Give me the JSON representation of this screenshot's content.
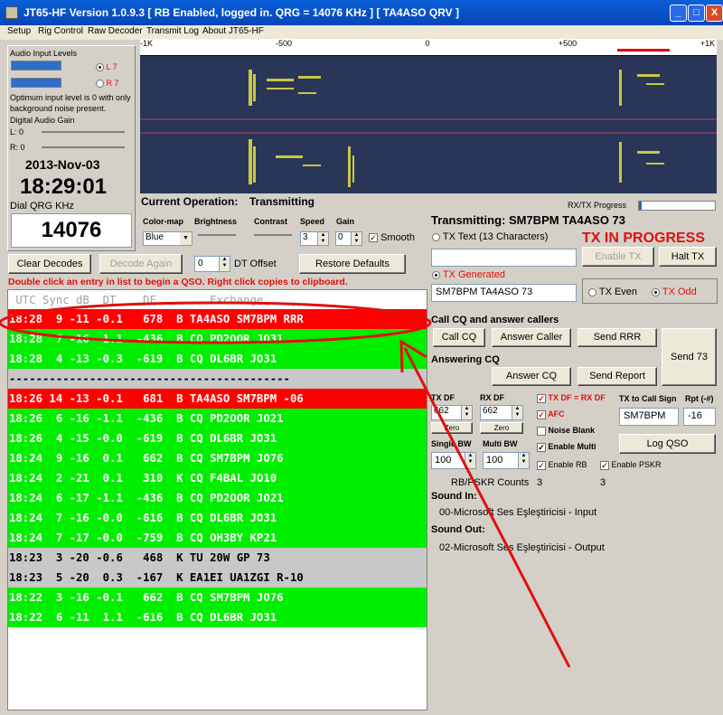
{
  "window": {
    "title": "JT65-HF Version 1.0.9.3  [ RB Enabled, logged in.  QRG = 14076 KHz ] [ TA4ASO QRV ]",
    "min": "_",
    "max": "□",
    "close": "X"
  },
  "menu": [
    "Setup",
    "Rig Control",
    "Raw Decoder",
    "Transmit Log",
    "About JT65-HF"
  ],
  "audio": {
    "title": "Audio Input Levels",
    "left": "L 7",
    "right": "R 7",
    "note": "Optimum input level is 0 with only background noise present.",
    "gain_title": "Digital Audio Gain",
    "gain_l": "L: 0",
    "gain_r": "R: 0"
  },
  "clock": {
    "date": "2013-Nov-03",
    "time": "18:29:01",
    "qrg_label": "Dial QRG KHz",
    "qrg": "14076"
  },
  "scale": {
    "labels": [
      "-1K",
      "-500",
      "0",
      "+500",
      "+1K"
    ]
  },
  "operation": {
    "label": "Current Operation:",
    "value": "Transmitting",
    "progress_label": "RX/TX Progress"
  },
  "waterfall_controls": {
    "colormap_label": "Color-map",
    "colormap": "Blue",
    "brightness": "Brightness",
    "contrast": "Contrast",
    "speed": "Speed",
    "speed_val": "3",
    "gain": "Gain",
    "gain_val": "0",
    "smooth": "Smooth"
  },
  "decode_buttons": {
    "clear": "Clear Decodes",
    "again": "Decode Again",
    "dt_val": "0",
    "dt": "DT Offset",
    "restore": "Restore Defaults"
  },
  "hint": "Double click an entry in list to begin a QSO.  Right click copies to clipboard.",
  "decode_header": " UTC Sync dB  DT    DF        Exchange",
  "decodes": [
    {
      "text": "18:28  9 -11 -0.1   678  B TA4ASO SM7BPM RRR",
      "c": "red"
    },
    {
      "text": "18:28  7 -16 -1.1  -436  B CQ PD2OOR JO31",
      "c": "green"
    },
    {
      "text": "18:28  4 -13 -0.3  -619  B CQ DL6BR JO31",
      "c": "green"
    },
    {
      "text": "------------------------------------------",
      "c": "sep"
    },
    {
      "text": "18:26 14 -13 -0.1   681  B TA4ASO SM7BPM -06",
      "c": "red"
    },
    {
      "text": "18:26  6 -16 -1.1  -436  B CQ PD2OOR JO21",
      "c": "green"
    },
    {
      "text": "18:26  4 -15 -0.0  -619  B CQ DL6BR JO31",
      "c": "green"
    },
    {
      "text": "18:24  9 -16  0.1   662  B CQ SM7BPM JO76",
      "c": "green"
    },
    {
      "text": "18:24  2 -21  0.1   310  K CQ F4BAL JO10",
      "c": "green"
    },
    {
      "text": "18:24  6 -17 -1.1  -436  B CQ PD2OOR JO21",
      "c": "green"
    },
    {
      "text": "18:24  7 -16 -0.0  -616  B CQ DL6BR JO31",
      "c": "green"
    },
    {
      "text": "18:24  7 -17 -0.0  -759  B CQ OH3BY KP21",
      "c": "green"
    },
    {
      "text": "18:23  3 -20 -0.6   468  K TU 20W GP 73",
      "c": "gray"
    },
    {
      "text": "18:23  5 -20  0.3  -167  K EA1EI UA1ZGI R-10",
      "c": "gray"
    },
    {
      "text": "18:22  3 -16 -0.1   662  B CQ SM7BPM JO76",
      "c": "green"
    },
    {
      "text": "18:22  6 -11  1.1  -616  B CQ DL6BR JO31",
      "c": "green"
    }
  ],
  "tx": {
    "status": "Transmitting: SM7BPM TA4ASO 73",
    "in_progress": "TX IN PROGRESS",
    "tx_text_label": "TX Text (13 Characters)",
    "enable_tx": "Enable TX",
    "halt_tx": "Halt TX",
    "tx_generated": "TX Generated",
    "message": "SM7BPM TA4ASO 73",
    "tx_even": "TX Even",
    "tx_odd": "TX Odd"
  },
  "cq": {
    "title": "Call CQ and answer callers",
    "call_cq": "Call CQ",
    "answer_caller": "Answer Caller",
    "send_rrr": "Send RRR",
    "send73": "Send 73",
    "answering": "Answering CQ",
    "answer_cq": "Answer CQ",
    "send_report": "Send Report"
  },
  "df": {
    "tx_df": "TX DF",
    "tx_val": "662",
    "rx_df": "RX DF",
    "rx_val": "662",
    "zero": "Zero",
    "txeqrx": "TX DF = RX DF",
    "afc": "AFC",
    "noise": "Noise Blank",
    "enable_multi": "Enable Multi",
    "enable_rb": "Enable RB",
    "enable_pskr": "Enable PSKR",
    "single_bw": "Single BW",
    "single_val": "100",
    "multi_bw": "Multi BW",
    "multi_val": "100",
    "tx_to": "TX to Call Sign",
    "rpt": "Rpt (-#)",
    "call": "SM7BPM",
    "rpt_val": "-16",
    "log_qso": "Log QSO",
    "counts_label": "RB/PSKR Counts",
    "count1": "3",
    "count2": "3",
    "sound_in": "Sound In:",
    "sound_in_val": "00-Microsoft Ses Eşleştiricisi - Input",
    "sound_out": "Sound Out:",
    "sound_out_val": "02-Microsoft Ses Eşleştiricisi - Output"
  },
  "colors": {
    "accent_red": "#e01010",
    "green": "#00ee00",
    "titlebar": "#0a5fd8"
  }
}
